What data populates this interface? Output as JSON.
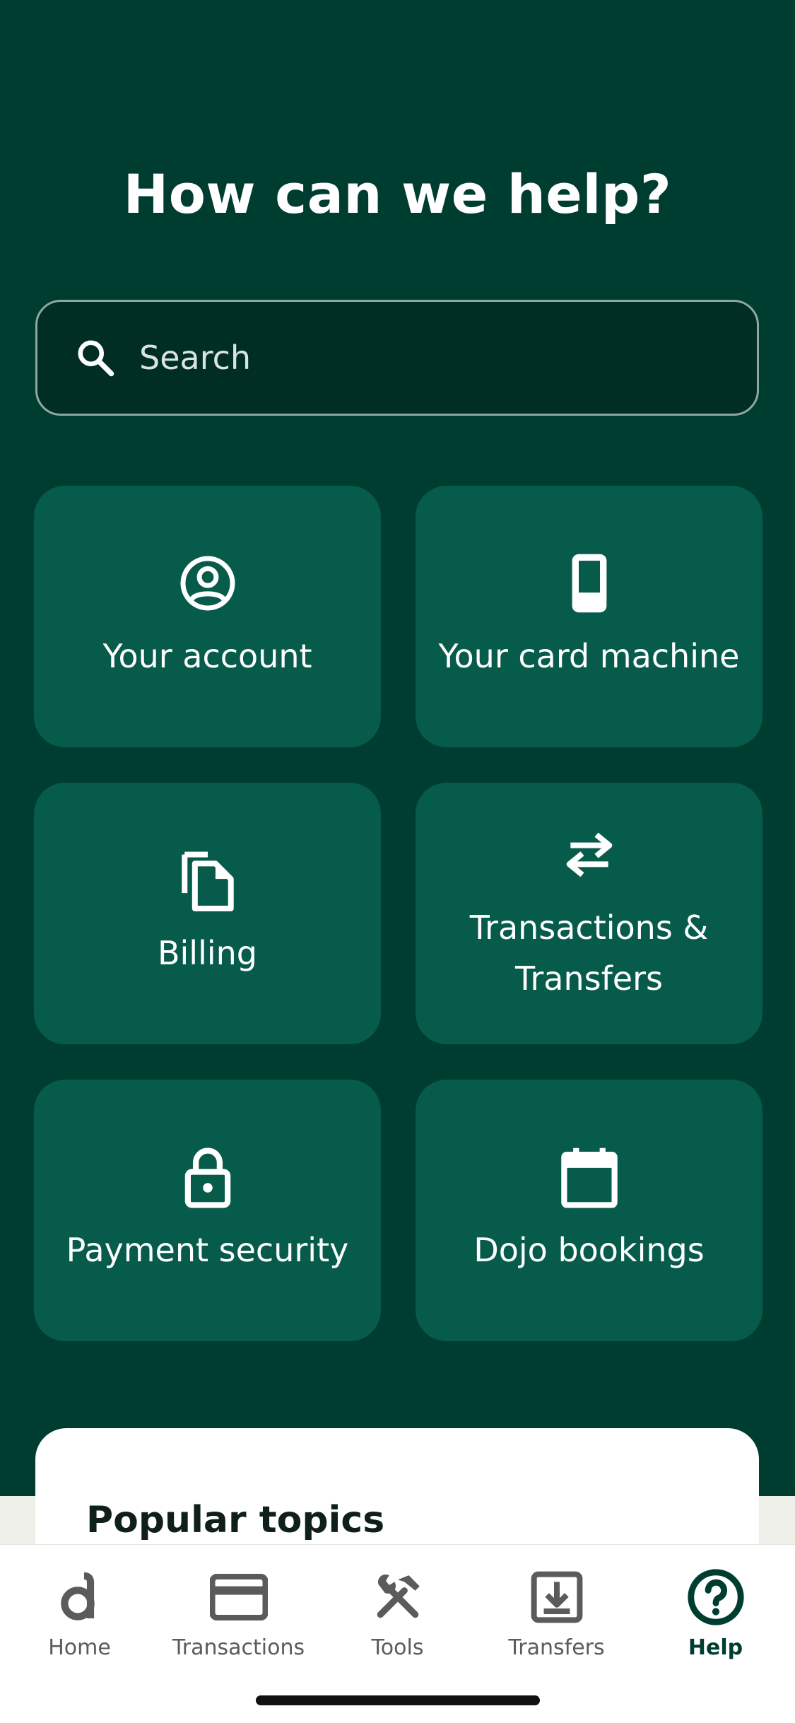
{
  "header": {
    "title": "How can we help?"
  },
  "search": {
    "placeholder": "Search"
  },
  "tiles": [
    {
      "label": "Your account",
      "icon": "account-circle-icon"
    },
    {
      "label": "Your card machine",
      "icon": "card-machine-icon"
    },
    {
      "label": "Billing",
      "icon": "documents-icon"
    },
    {
      "label": "Transactions & Transfers",
      "icon": "swap-arrows-icon"
    },
    {
      "label": "Payment security",
      "icon": "lock-icon"
    },
    {
      "label": "Dojo bookings",
      "icon": "calendar-icon"
    }
  ],
  "topics": {
    "title": "Popular topics"
  },
  "tabbar": {
    "items": [
      {
        "label": "Home",
        "icon": "dojo-logo-icon"
      },
      {
        "label": "Transactions",
        "icon": "card-icon"
      },
      {
        "label": "Tools",
        "icon": "tools-icon"
      },
      {
        "label": "Transfers",
        "icon": "download-tray-icon"
      },
      {
        "label": "Help",
        "icon": "help-circle-icon"
      }
    ],
    "active": "Help"
  },
  "colors": {
    "background": "#003d31",
    "tile": "#075b4a",
    "active_tab": "#003d31",
    "inactive_tab": "#5b5b5b"
  }
}
